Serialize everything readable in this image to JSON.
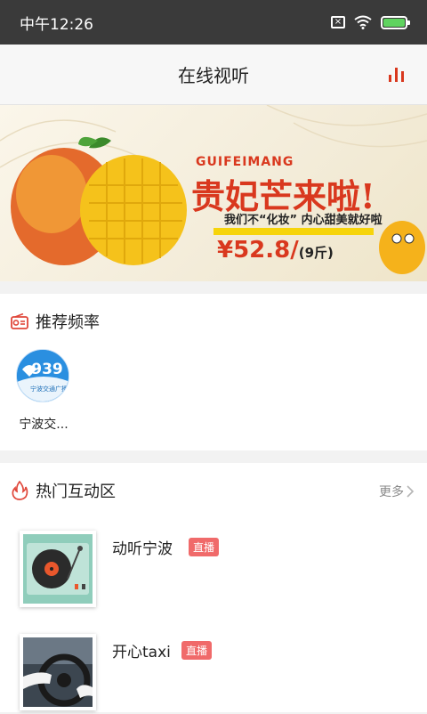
{
  "status_bar": {
    "time": "中午12:26",
    "sim_icon": "sim-x-icon",
    "wifi_icon": "wifi-icon",
    "battery_icon": "battery-charging-icon"
  },
  "header": {
    "title": "在线视听",
    "equalizer_icon": "equalizer-icon"
  },
  "banner": {
    "brand_en": "GUIFEIMANG",
    "headline": "贵妃芒来啦!",
    "tagline": "我们不“化妆” 内心甜美就好啦",
    "price": "¥52.8/",
    "price_unit": "(9斤)"
  },
  "recommended": {
    "title": "推荐频率",
    "icon": "radio-icon",
    "channels": [
      {
        "name": "宁波交...",
        "logo_text": "939",
        "logo_sub": "宁波交通广播"
      }
    ]
  },
  "hot": {
    "title": "热门互动区",
    "icon": "flame-icon",
    "more_label": "更多",
    "items": [
      {
        "title": "动听宁波",
        "badge": "直播"
      },
      {
        "title": "开心taxi",
        "badge": "直播"
      }
    ]
  },
  "colors": {
    "accent": "#d9381e",
    "badge": "#f06a6a",
    "statusbar": "#3a3a3a"
  }
}
